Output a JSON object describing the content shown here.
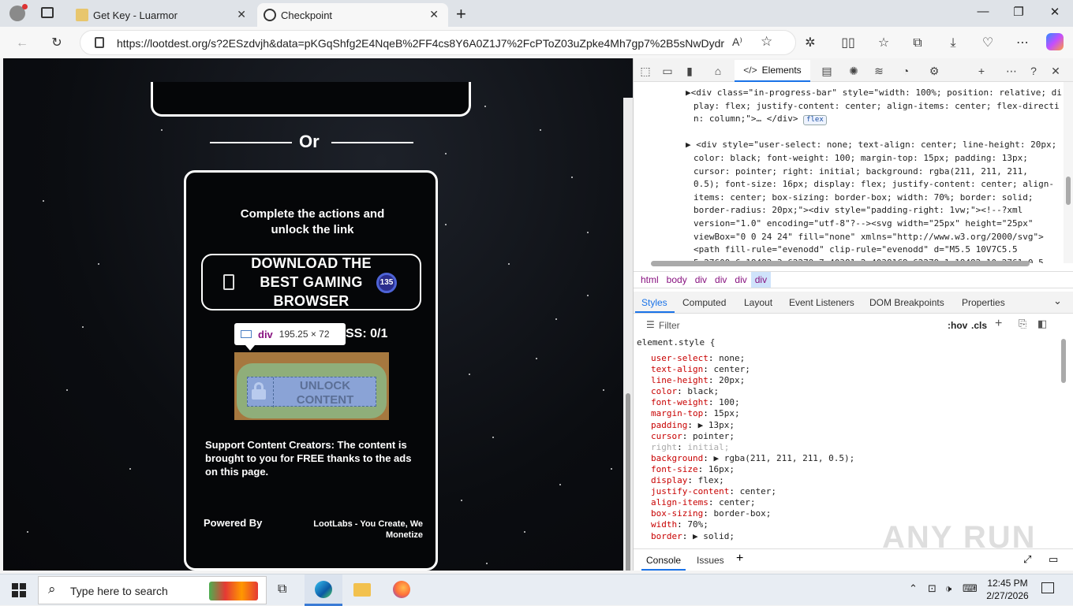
{
  "tabs": [
    {
      "label": "Get Key - Luarmor"
    },
    {
      "label": "Checkpoint"
    }
  ],
  "address": {
    "url": "https://lootdest.org/s?2ESzdvjh&data=pKGqShfg2E4NqeB%2FF4cs8Y6A0Z1J7%2FcPToZ03uZpke4Mh7gp7%2B5sNwDydr..."
  },
  "page": {
    "or_label": "Or",
    "heading": "Complete the actions and unlock the link",
    "download_label": "DOWNLOAD THE BEST GAMING BROWSER",
    "progress_label": "SS: 0/1",
    "badge": "135",
    "unlock_label": "UNLOCK CONTENT",
    "support_text": "Support Content Creators: The content is brought to you for FREE thanks to the ads on this page.",
    "powered_by": "Powered By",
    "lootlabs": "LootLabs - You Create, We Monetize"
  },
  "tooltip": {
    "tag": "div",
    "size": "195.25 × 72"
  },
  "devtools": {
    "elements_tab": "Elements",
    "dom_lines": [
      {
        "indent": 0,
        "text": "▶<div class=\"in-progress-bar\" style=\"width: 100%; position: relative; di"
      },
      {
        "indent": 1,
        "text": "play: flex; justify-content: center; align-items: center; flex-directi"
      },
      {
        "indent": 1,
        "text": "n: column;\">… </div>"
      },
      {
        "indent": 0,
        "text": " "
      },
      {
        "indent": 0,
        "text": "▶ <div style=\"user-select: none; text-align: center; line-height: 20px;"
      },
      {
        "indent": 1,
        "text": "color: black; font-weight: 100; margin-top: 15px; padding: 13px;"
      },
      {
        "indent": 1,
        "text": "cursor: pointer; right: initial; background: rgba(211, 211, 211,"
      },
      {
        "indent": 1,
        "text": "0.5); font-size: 16px; display: flex; justify-content: center; align-"
      },
      {
        "indent": 1,
        "text": "items: center; box-sizing: border-box; width: 70%; border: solid;"
      },
      {
        "indent": 1,
        "text": "border-radius: 20px;\"><div style=\"padding-right: 1vw;\"><!--?xml"
      },
      {
        "indent": 1,
        "text": "version=\"1.0\" encoding=\"utf-8\"?--><svg width=\"25px\" height=\"25px\""
      },
      {
        "indent": 1,
        "text": "viewBox=\"0 0 24 24\" fill=\"none\" xmlns=\"http://www.w3.org/2000/svg\">"
      },
      {
        "indent": 1,
        "text": "<path fill-rule=\"evenodd\" clip-rule=\"evenodd\" d=\"M5.5 10V7C5.5"
      },
      {
        "indent": 1,
        "text": "5.27609 6.18482 3.62279 7.40381 2.40381C8.62279 1.18482 10.2761 0.5"
      }
    ],
    "flex_badge": "flex",
    "breadcrumb": [
      "html",
      "body",
      "div",
      "div",
      "div",
      "div"
    ],
    "style_tabs": [
      "Styles",
      "Computed",
      "Layout",
      "Event Listeners",
      "DOM Breakpoints",
      "Properties"
    ],
    "filter_placeholder": "Filter",
    "hov": ":hov",
    "cls": ".cls",
    "element_style": "element.style {",
    "css_props": [
      {
        "name": "user-select",
        "value": "none;"
      },
      {
        "name": "text-align",
        "value": "center;"
      },
      {
        "name": "line-height",
        "value": "20px;"
      },
      {
        "name": "color",
        "value": "black;"
      },
      {
        "name": "font-weight",
        "value": "100;"
      },
      {
        "name": "margin-top",
        "value": "15px;"
      },
      {
        "name": "padding",
        "value": "▶ 13px;"
      },
      {
        "name": "cursor",
        "value": "pointer;"
      },
      {
        "name": "right",
        "value": "initial;"
      },
      {
        "name": "background",
        "value": "▶ rgba(211, 211, 211, 0.5);"
      },
      {
        "name": "font-size",
        "value": "16px;"
      },
      {
        "name": "display",
        "value": "flex;"
      },
      {
        "name": "justify-content",
        "value": "center;"
      },
      {
        "name": "align-items",
        "value": "center;"
      },
      {
        "name": "box-sizing",
        "value": "border-box;"
      },
      {
        "name": "width",
        "value": "70%;"
      },
      {
        "name": "border",
        "value": "▶ solid;"
      }
    ],
    "drawer_tabs": [
      "Console",
      "Issues"
    ]
  },
  "taskbar": {
    "search_placeholder": "Type here to search",
    "time": "12:45 PM",
    "date": "2/27/2026"
  },
  "watermark": "ANY RUN"
}
